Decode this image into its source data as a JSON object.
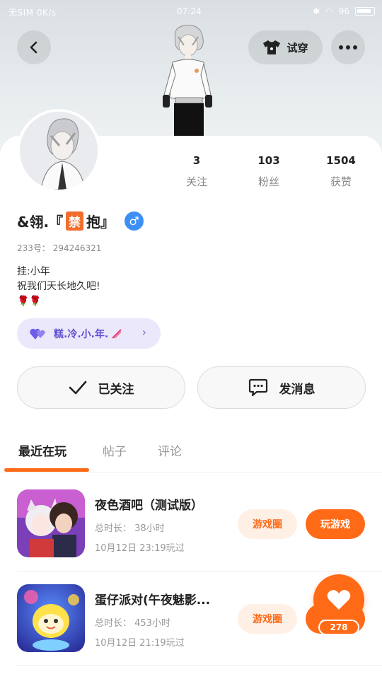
{
  "status_bar": {
    "carrier": "无SIM 0K/s",
    "time": "07:24",
    "battery": "96"
  },
  "header": {
    "try_on_label": "试穿"
  },
  "profile": {
    "stats": [
      {
        "value": "3",
        "label": "关注"
      },
      {
        "value": "103",
        "label": "粉丝"
      },
      {
        "value": "1504",
        "label": "获赞"
      }
    ],
    "name_prefix": "&翎.『",
    "name_badge": "禁",
    "name_suffix": "抱』",
    "gender_symbol": "♂",
    "uid": "233号： 294246321",
    "bio_lines": [
      "挂:小年",
      "祝我们天长地久吧!",
      "🌹🌹"
    ],
    "tag_pill_text": "糕.冷.小.年."
  },
  "actions": {
    "follow_label": "已关注",
    "message_label": "发消息"
  },
  "tabs": [
    {
      "label": "最近在玩",
      "active": true
    },
    {
      "label": "帖子",
      "active": false
    },
    {
      "label": "评论",
      "active": false
    }
  ],
  "games": [
    {
      "title": "夜色酒吧（测试版）",
      "play_time": "总时长： 38小时",
      "last_played": "10月12日 23:19玩过",
      "circle_label": "游戏圈",
      "play_label": "玩游戏"
    },
    {
      "title": "蛋仔派对(午夜魅影...",
      "play_time": "总时长： 453小时",
      "last_played": "10月12日 21:19玩过",
      "circle_label": "游戏圈",
      "play_label": "玩游戏"
    }
  ],
  "like_fab": {
    "count": "278"
  },
  "colors": {
    "accent": "#ff6a17",
    "pill_bg": "#ebe8fb",
    "pill_text": "#5f4fd1",
    "gender": "#3d8ff5"
  }
}
